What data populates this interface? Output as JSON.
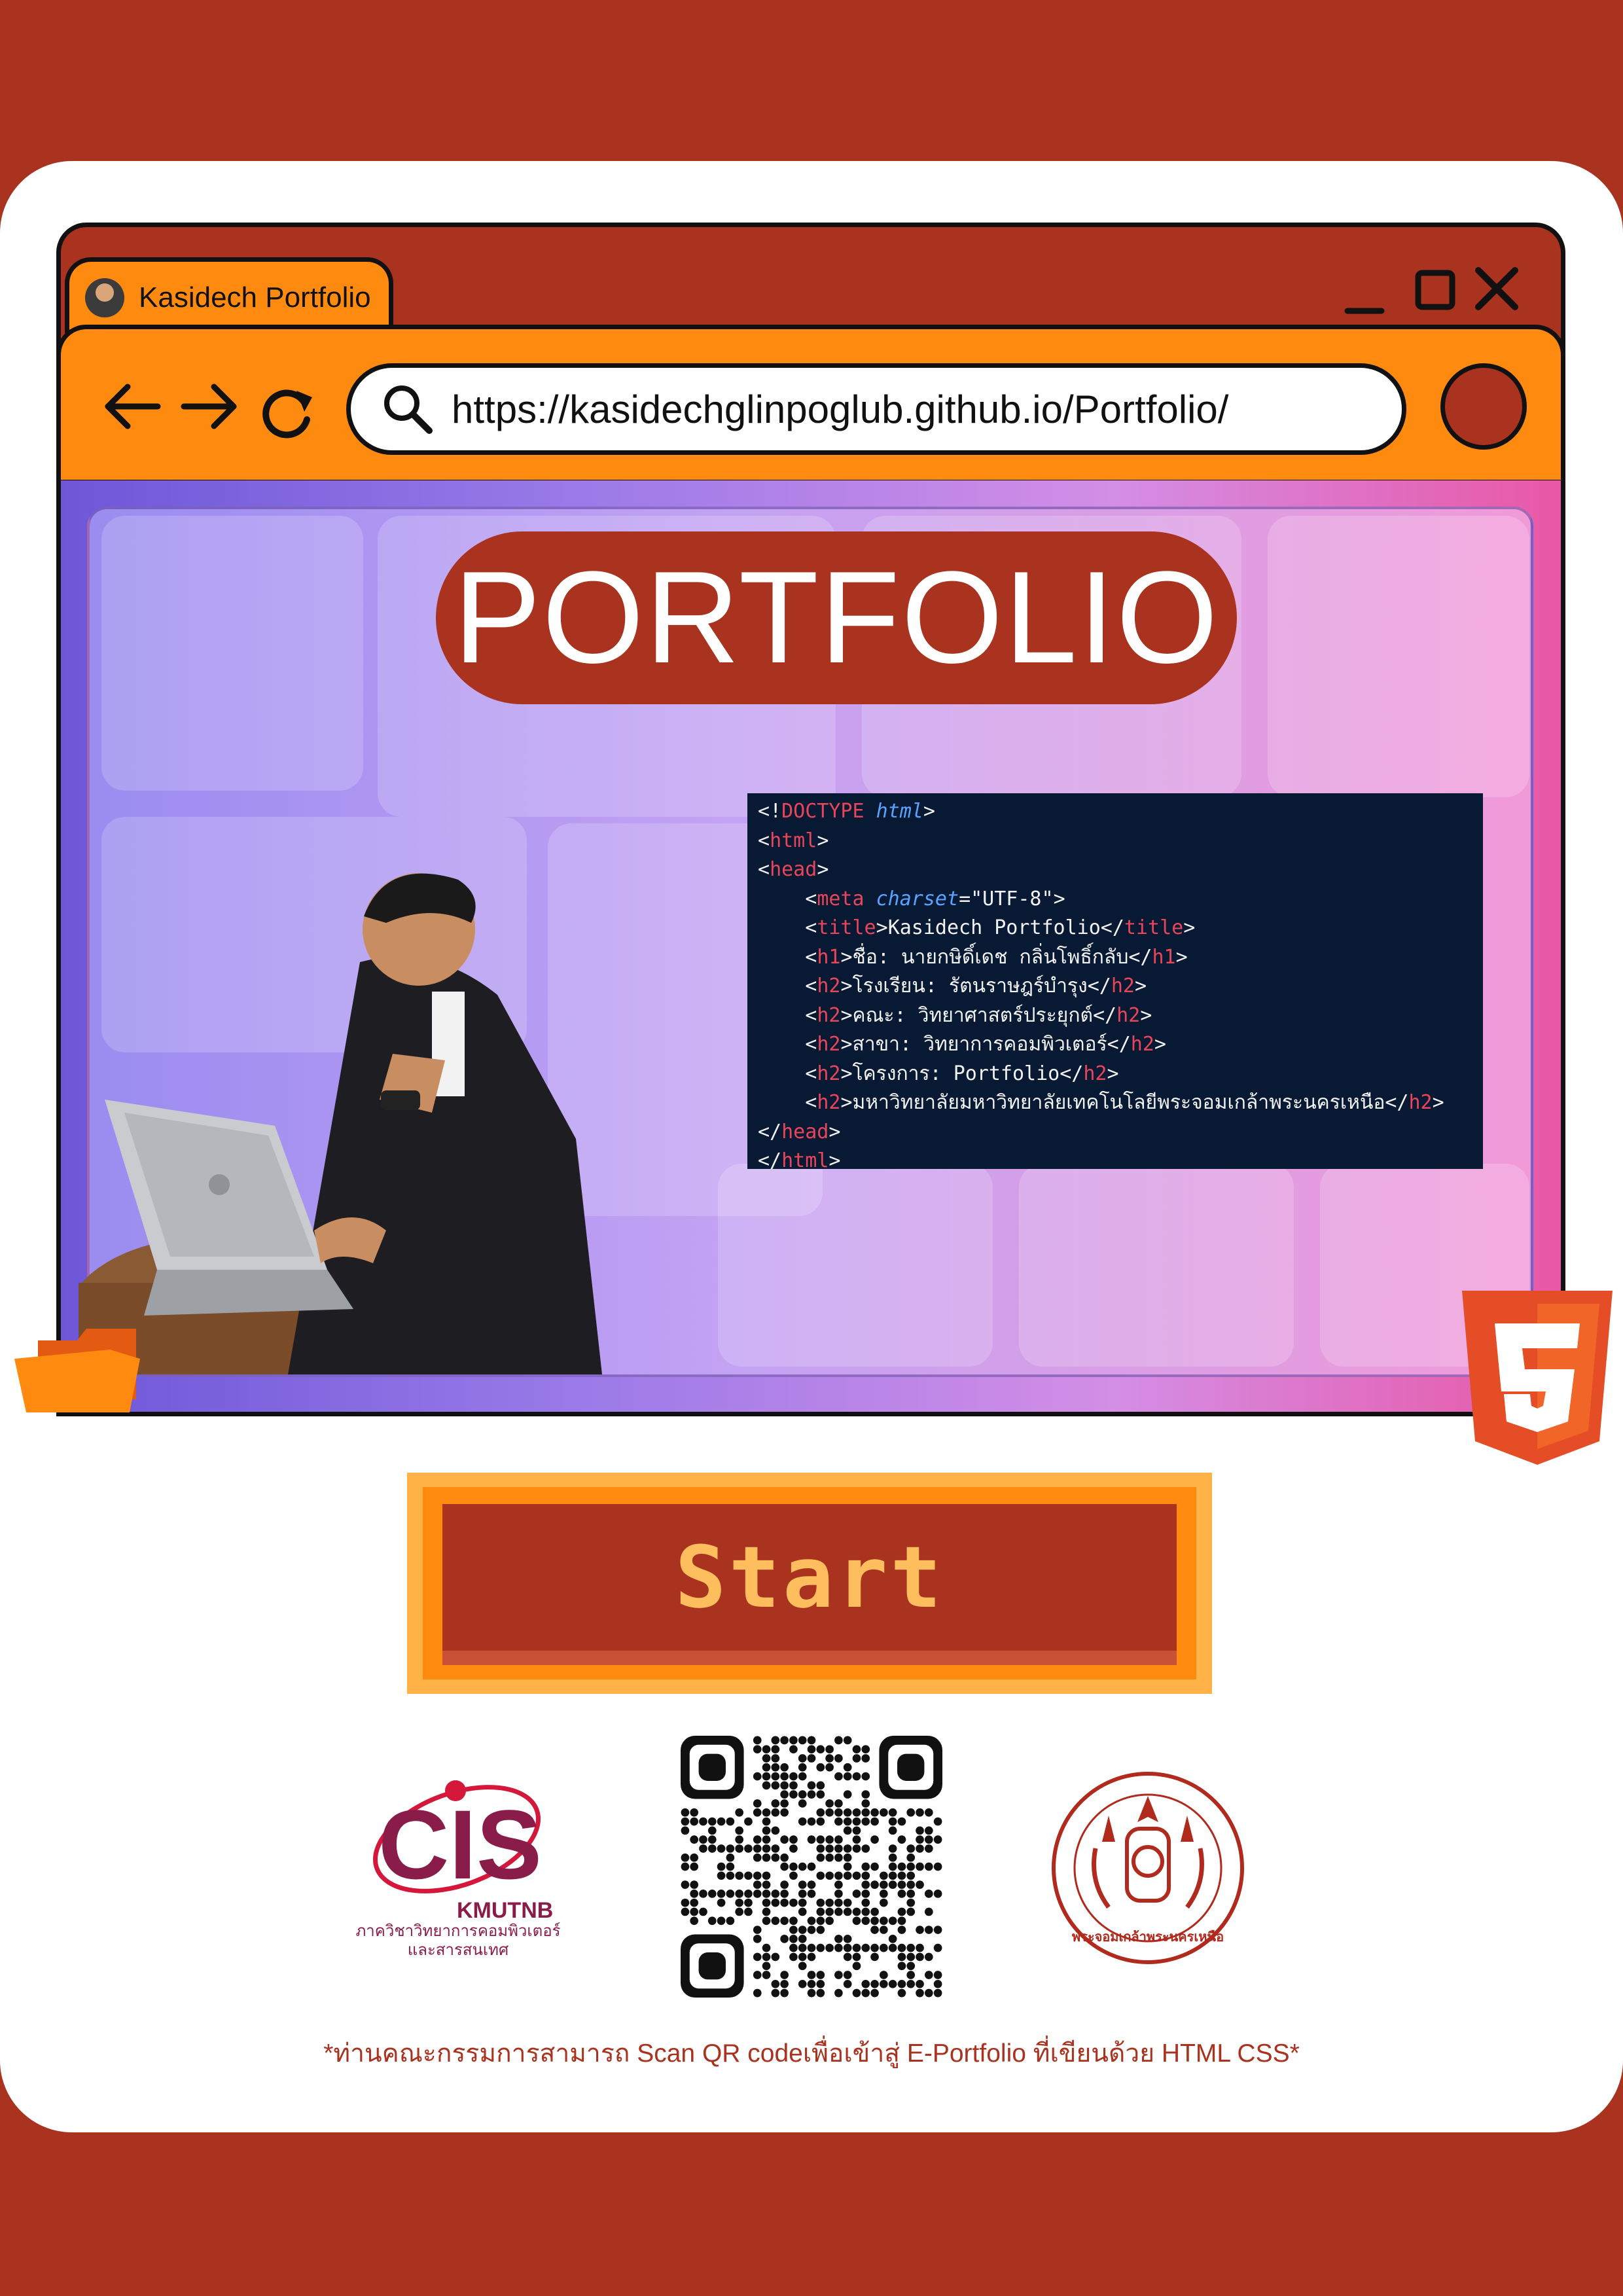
{
  "browser": {
    "tab_title": "Kasidech Portfolio",
    "url": "https://kasidechglinpoglub.github.io/Portfolio/",
    "controls": [
      "minimize-icon",
      "maximize-icon",
      "close-icon"
    ],
    "nav_icons": [
      "back-arrow-icon",
      "forward-arrow-icon",
      "reload-icon",
      "search-icon"
    ]
  },
  "hero": {
    "title": "PORTFOLIO"
  },
  "code_lines": [
    "<!DOCTYPE html>",
    "<html>",
    "<head>",
    "    <meta charset=\"UTF-8\">",
    "    <title>Kasidech Portfolio</title>",
    "    <h1>ชื่อ: นายกษิดิ์เดช กลิ่นโพธิ์กลับ</h1>",
    "    <h2>โรงเรียน: รัตนราษฎร์บำรุง</h2>",
    "    <h2>คณะ: วิทยาศาสตร์ประยุกต์</h2>",
    "    <h2>สาขา: วิทยาการคอมพิวเตอร์</h2>",
    "    <h2>โครงการ: Portfolio</h2>",
    "    <h2>มหาวิทยาลัยมหาวิทยาลัยเทคโนโลยีพระจอมเกล้าพระนครเหนือ</h2>",
    "</head>",
    "</html>"
  ],
  "start_button": {
    "label": "Start"
  },
  "logos": {
    "cis_caption_1": "ภาควิชาวิทยาการคอมพิวเตอร์",
    "cis_caption_2": "และสารสนเทศ",
    "cis_text": "KMUTNB",
    "seal_text": "พระจอมเกล้าพระนครเหนือ"
  },
  "footer_note": "*ท่านคณะกรรมการสามารถ Scan QR codeเพื่อเข้าสู่ E-Portfolio ที่เขียนด้วย HTML CSS*",
  "colors": {
    "brand": "#a9331f",
    "orange": "#ff8a10",
    "code_bg": "#081a33"
  }
}
